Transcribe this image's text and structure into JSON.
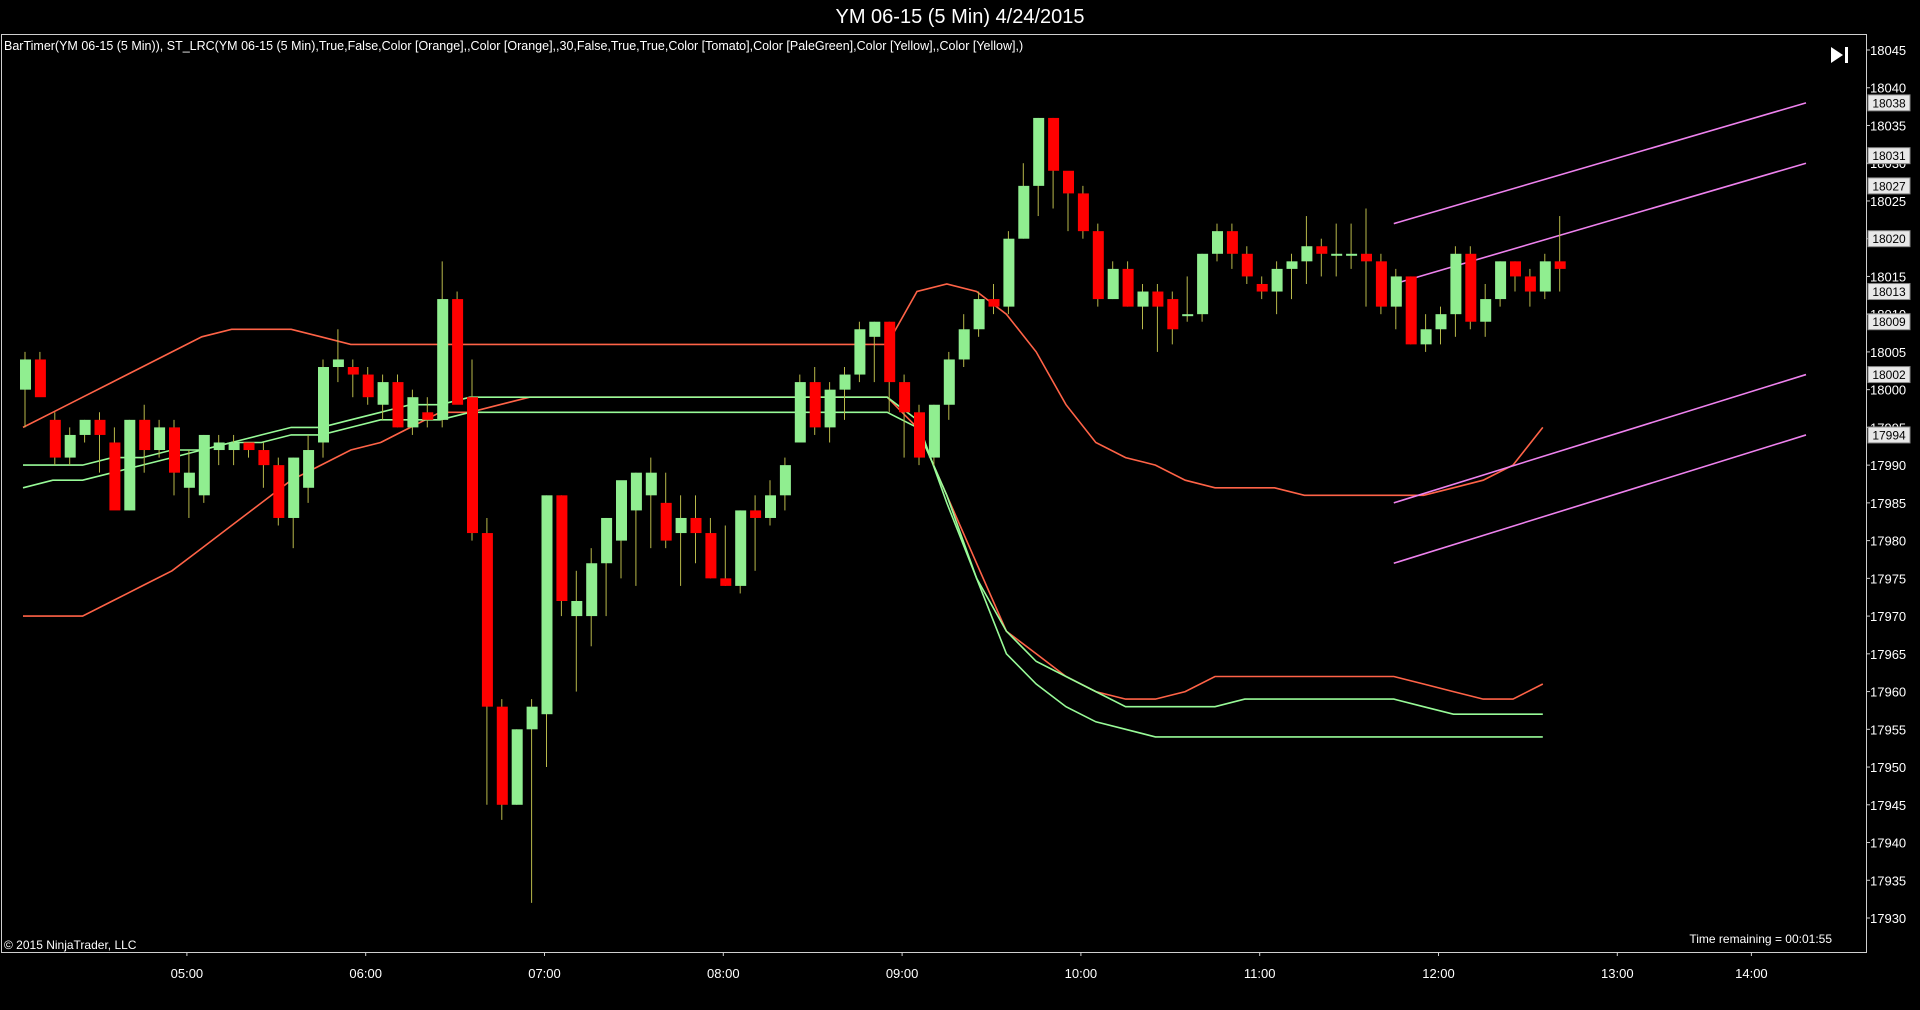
{
  "header": {
    "title": "YM 06-15 (5 Min)  4/24/2015"
  },
  "indicator_label": "BarTimer(YM  06-15  (5  Min)),  ST_LRC(YM  06-15  (5  Min),True,False,Color  [Orange],,Color  [Orange],,30,False,True,True,Color  [Tomato],Color  [PaleGreen],Color  [Yellow],,Color  [Yellow],)",
  "footer": {
    "copyright": "© 2015 NinjaTrader, LLC",
    "time_remaining": "Time remaining = 00:01:55"
  },
  "controls": {
    "scroll_end_icon": "skip-to-end-icon"
  },
  "colors": {
    "background": "#000000",
    "up": "#90EE90",
    "down": "#FF0000",
    "tomato": "#FF6347",
    "palegreen": "#98FB98",
    "channel": "#EE82EE",
    "grid_text": "#FFFFFF"
  },
  "chart_data": {
    "type": "candlestick",
    "title": "YM 06-15 (5 Min)  4/24/2015",
    "ylim": [
      17927,
      18046
    ],
    "yticks": [
      17930,
      17935,
      17940,
      17945,
      17950,
      17955,
      17960,
      17965,
      17970,
      17975,
      17980,
      17985,
      17990,
      17995,
      18000,
      18005,
      18010,
      18015,
      18020,
      18025,
      18030,
      18035,
      18040,
      18045
    ],
    "xtick_labels": [
      "05:00",
      "06:00",
      "07:00",
      "08:00",
      "09:00",
      "10:00",
      "11:00",
      "12:00",
      "13:00",
      "14:00"
    ],
    "xtick_bar_index": [
      11,
      23,
      35,
      47,
      59,
      71,
      83,
      95,
      107,
      116
    ],
    "price_labels": [
      18038,
      18031,
      18027,
      18020,
      18013,
      18009,
      18002,
      17994
    ],
    "candles": [
      {
        "o": 18000,
        "h": 18005,
        "l": 17995,
        "c": 18004
      },
      {
        "o": 18004,
        "h": 18005,
        "l": 18000,
        "c": 17999
      },
      {
        "o": 17996,
        "h": 17997,
        "l": 17990,
        "c": 17991
      },
      {
        "o": 17991,
        "h": 17995,
        "l": 17990,
        "c": 17994
      },
      {
        "o": 17994,
        "h": 17996,
        "l": 17993,
        "c": 17996
      },
      {
        "o": 17996,
        "h": 17997,
        "l": 17989,
        "c": 17994
      },
      {
        "o": 17993,
        "h": 17995,
        "l": 17985,
        "c": 17984
      },
      {
        "o": 17984,
        "h": 17996,
        "l": 17984,
        "c": 17996
      },
      {
        "o": 17996,
        "h": 17998,
        "l": 17989,
        "c": 17992
      },
      {
        "o": 17992,
        "h": 17996,
        "l": 17991,
        "c": 17995
      },
      {
        "o": 17995,
        "h": 17996,
        "l": 17986,
        "c": 17989
      },
      {
        "o": 17987,
        "h": 17992,
        "l": 17983,
        "c": 17989
      },
      {
        "o": 17986,
        "h": 17994,
        "l": 17985,
        "c": 17994
      },
      {
        "o": 17992,
        "h": 17994,
        "l": 17990,
        "c": 17993
      },
      {
        "o": 17992,
        "h": 17994,
        "l": 17990,
        "c": 17993
      },
      {
        "o": 17993,
        "h": 17993,
        "l": 17991,
        "c": 17992
      },
      {
        "o": 17992,
        "h": 17993,
        "l": 17987,
        "c": 17990
      },
      {
        "o": 17990,
        "h": 17991,
        "l": 17982,
        "c": 17983
      },
      {
        "o": 17983,
        "h": 17991,
        "l": 17979,
        "c": 17991
      },
      {
        "o": 17987,
        "h": 17994,
        "l": 17985,
        "c": 17992
      },
      {
        "o": 17993,
        "h": 18004,
        "l": 17991,
        "c": 18003
      },
      {
        "o": 18003,
        "h": 18008,
        "l": 18001,
        "c": 18004
      },
      {
        "o": 18003,
        "h": 18004,
        "l": 17999,
        "c": 18002
      },
      {
        "o": 18002,
        "h": 18003,
        "l": 17998,
        "c": 17999
      },
      {
        "o": 17998,
        "h": 18002,
        "l": 17996,
        "c": 18001
      },
      {
        "o": 18001,
        "h": 18002,
        "l": 17995,
        "c": 17995
      },
      {
        "o": 17995,
        "h": 18000,
        "l": 17994,
        "c": 17999
      },
      {
        "o": 17997,
        "h": 17999,
        "l": 17995,
        "c": 17996
      },
      {
        "o": 17996,
        "h": 18017,
        "l": 17995,
        "c": 18012
      },
      {
        "o": 18012,
        "h": 18013,
        "l": 18004,
        "c": 17998
      },
      {
        "o": 17999,
        "h": 18004,
        "l": 17980,
        "c": 17981
      },
      {
        "o": 17981,
        "h": 17983,
        "l": 17945,
        "c": 17958
      },
      {
        "o": 17958,
        "h": 17959,
        "l": 17943,
        "c": 17945
      },
      {
        "o": 17945,
        "h": 17955,
        "l": 17945,
        "c": 17955
      },
      {
        "o": 17955,
        "h": 17959,
        "l": 17932,
        "c": 17958
      },
      {
        "o": 17957,
        "h": 17986,
        "l": 17950,
        "c": 17986
      },
      {
        "o": 17986,
        "h": 17986,
        "l": 17970,
        "c": 17972
      },
      {
        "o": 17970,
        "h": 17976,
        "l": 17960,
        "c": 17972
      },
      {
        "o": 17970,
        "h": 17979,
        "l": 17966,
        "c": 17977
      },
      {
        "o": 17977,
        "h": 17983,
        "l": 17970,
        "c": 17983
      },
      {
        "o": 17980,
        "h": 17985,
        "l": 17975,
        "c": 17988
      },
      {
        "o": 17984,
        "h": 17989,
        "l": 17974,
        "c": 17989
      },
      {
        "o": 17986,
        "h": 17991,
        "l": 17979,
        "c": 17989
      },
      {
        "o": 17985,
        "h": 17989,
        "l": 17979,
        "c": 17980
      },
      {
        "o": 17981,
        "h": 17986,
        "l": 17974,
        "c": 17983
      },
      {
        "o": 17983,
        "h": 17986,
        "l": 17977,
        "c": 17981
      },
      {
        "o": 17981,
        "h": 17983,
        "l": 17975,
        "c": 17975
      },
      {
        "o": 17975,
        "h": 17982,
        "l": 17974,
        "c": 17974
      },
      {
        "o": 17974,
        "h": 17984,
        "l": 17973,
        "c": 17984
      },
      {
        "o": 17984,
        "h": 17986,
        "l": 17976,
        "c": 17983
      },
      {
        "o": 17983,
        "h": 17988,
        "l": 17982,
        "c": 17986
      },
      {
        "o": 17986,
        "h": 17991,
        "l": 17984,
        "c": 17990
      },
      {
        "o": 17993,
        "h": 18002,
        "l": 17993,
        "c": 18001
      },
      {
        "o": 18001,
        "h": 18003,
        "l": 17994,
        "c": 17995
      },
      {
        "o": 17995,
        "h": 18001,
        "l": 17993,
        "c": 18000
      },
      {
        "o": 18000,
        "h": 18003,
        "l": 17996,
        "c": 18002
      },
      {
        "o": 18002,
        "h": 18009,
        "l": 18001,
        "c": 18008
      },
      {
        "o": 18007,
        "h": 18009,
        "l": 18001,
        "c": 18009
      },
      {
        "o": 18009,
        "h": 18009,
        "l": 17997,
        "c": 18001
      },
      {
        "o": 18001,
        "h": 18002,
        "l": 17991,
        "c": 17997
      },
      {
        "o": 17997,
        "h": 17998,
        "l": 17990,
        "c": 17991
      },
      {
        "o": 17991,
        "h": 17998,
        "l": 17990,
        "c": 17998
      },
      {
        "o": 17998,
        "h": 18005,
        "l": 17996,
        "c": 18004
      },
      {
        "o": 18004,
        "h": 18010,
        "l": 18003,
        "c": 18008
      },
      {
        "o": 18008,
        "h": 18013,
        "l": 18007,
        "c": 18012
      },
      {
        "o": 18012,
        "h": 18014,
        "l": 18010,
        "c": 18011
      },
      {
        "o": 18011,
        "h": 18021,
        "l": 18010,
        "c": 18020
      },
      {
        "o": 18020,
        "h": 18030,
        "l": 18020,
        "c": 18027
      },
      {
        "o": 18027,
        "h": 18036,
        "l": 18023,
        "c": 18036
      },
      {
        "o": 18036,
        "h": 18036,
        "l": 18024,
        "c": 18029
      },
      {
        "o": 18029,
        "h": 18028,
        "l": 18021,
        "c": 18026
      },
      {
        "o": 18026,
        "h": 18027,
        "l": 18020,
        "c": 18021
      },
      {
        "o": 18021,
        "h": 18022,
        "l": 18011,
        "c": 18012
      },
      {
        "o": 18012,
        "h": 18017,
        "l": 18012,
        "c": 18016
      },
      {
        "o": 18016,
        "h": 18017,
        "l": 18011,
        "c": 18011
      },
      {
        "o": 18011,
        "h": 18014,
        "l": 18008,
        "c": 18013
      },
      {
        "o": 18013,
        "h": 18014,
        "l": 18005,
        "c": 18011
      },
      {
        "o": 18012,
        "h": 18013,
        "l": 18006,
        "c": 18008
      },
      {
        "o": 18010,
        "h": 18015,
        "l": 18009,
        "c": 18010
      },
      {
        "o": 18010,
        "h": 18018,
        "l": 18009,
        "c": 18018
      },
      {
        "o": 18018,
        "h": 18022,
        "l": 18017,
        "c": 18021
      },
      {
        "o": 18021,
        "h": 18022,
        "l": 18016,
        "c": 18018
      },
      {
        "o": 18018,
        "h": 18019,
        "l": 18014,
        "c": 18015
      },
      {
        "o": 18014,
        "h": 18015,
        "l": 18012,
        "c": 18013
      },
      {
        "o": 18013,
        "h": 18017,
        "l": 18010,
        "c": 18016
      },
      {
        "o": 18016,
        "h": 18018,
        "l": 18012,
        "c": 18017
      },
      {
        "o": 18017,
        "h": 18023,
        "l": 18014,
        "c": 18019
      },
      {
        "o": 18019,
        "h": 18020,
        "l": 18015,
        "c": 18018
      },
      {
        "o": 18018,
        "h": 18022,
        "l": 18015,
        "c": 18018
      },
      {
        "o": 18018,
        "h": 18022,
        "l": 18016,
        "c": 18018
      },
      {
        "o": 18018,
        "h": 18024,
        "l": 18011,
        "c": 18017
      },
      {
        "o": 18017,
        "h": 18018,
        "l": 18010,
        "c": 18011
      },
      {
        "o": 18011,
        "h": 18016,
        "l": 18008,
        "c": 18015
      },
      {
        "o": 18015,
        "h": 18015,
        "l": 18006,
        "c": 18006
      },
      {
        "o": 18006,
        "h": 18010,
        "l": 18005,
        "c": 18008
      },
      {
        "o": 18008,
        "h": 18011,
        "l": 18006,
        "c": 18010
      },
      {
        "o": 18010,
        "h": 18019,
        "l": 18007,
        "c": 18018
      },
      {
        "o": 18018,
        "h": 18019,
        "l": 18008,
        "c": 18009
      },
      {
        "o": 18009,
        "h": 18014,
        "l": 18007,
        "c": 18012
      },
      {
        "o": 18012,
        "h": 18017,
        "l": 18011,
        "c": 18017
      },
      {
        "o": 18017,
        "h": 18017,
        "l": 18013,
        "c": 18015
      },
      {
        "o": 18015,
        "h": 18016,
        "l": 18011,
        "c": 18013
      },
      {
        "o": 18013,
        "h": 18018,
        "l": 18012,
        "c": 18017
      },
      {
        "o": 18017,
        "h": 18023,
        "l": 18013,
        "c": 18016
      }
    ],
    "overlay_lines": {
      "tomato_outer": [
        17970,
        17970,
        17970,
        17972,
        17974,
        17976,
        17979,
        17982,
        17985,
        17988,
        17990,
        17992,
        17993,
        17995,
        17997,
        17997,
        17998,
        17999,
        17999,
        17999,
        17999,
        17999,
        17999,
        17999,
        17999,
        17999,
        17999,
        17999,
        17999,
        17999,
        17995,
        17986,
        17977,
        17968,
        17965,
        17962,
        17960,
        17959,
        17959,
        17960,
        17962,
        17962,
        17962,
        17962,
        17962,
        17962,
        17962,
        17961,
        17960,
        17959,
        17959,
        17961
      ],
      "tomato_upper": [
        17995,
        17997,
        17999,
        18001,
        18003,
        18005,
        18007,
        18008,
        18008,
        18008,
        18007,
        18006,
        18006,
        18006,
        18006,
        18006,
        18006,
        18006,
        18006,
        18006,
        18006,
        18006,
        18006,
        18006,
        18006,
        18006,
        18006,
        18006,
        18006,
        18006,
        18013,
        18014,
        18013,
        18010,
        18005,
        17998,
        17993,
        17991,
        17990,
        17988,
        17987,
        17987,
        17987,
        17986,
        17986,
        17986,
        17986,
        17986,
        17987,
        17988,
        17990,
        17995
      ],
      "green_outer": [
        17990,
        17990,
        17990,
        17991,
        17991,
        17992,
        17992,
        17993,
        17994,
        17995,
        17995,
        17996,
        17997,
        17998,
        17998,
        17999,
        17999,
        17999,
        17999,
        17999,
        17999,
        17999,
        17999,
        17999,
        17999,
        17999,
        17999,
        17999,
        17999,
        17999,
        17996,
        17985,
        17975,
        17968,
        17964,
        17962,
        17960,
        17958,
        17958,
        17958,
        17958,
        17959,
        17959,
        17959,
        17959,
        17959,
        17959,
        17958,
        17957,
        17957,
        17957,
        17957
      ],
      "green_inner": [
        17987,
        17988,
        17988,
        17989,
        17990,
        17991,
        17992,
        17993,
        17993,
        17994,
        17994,
        17995,
        17996,
        17996,
        17996,
        17997,
        17997,
        17997,
        17997,
        17997,
        17997,
        17997,
        17997,
        17997,
        17997,
        17997,
        17997,
        17997,
        17997,
        17997,
        17995,
        17986,
        17975,
        17965,
        17961,
        17958,
        17956,
        17955,
        17954,
        17954,
        17954,
        17954,
        17954,
        17954,
        17954,
        17954,
        17954,
        17954,
        17954,
        17954,
        17954,
        17954
      ]
    },
    "regression_channel": {
      "start_bar": 92,
      "end_bar": 122,
      "upper_start": 18022,
      "upper_end": 18038,
      "mid_upper_start": 18014,
      "mid_upper_end": 18030,
      "mid_lower_start": 17985,
      "mid_lower_end": 18002,
      "lower_start": 17977,
      "lower_end": 17994
    }
  }
}
